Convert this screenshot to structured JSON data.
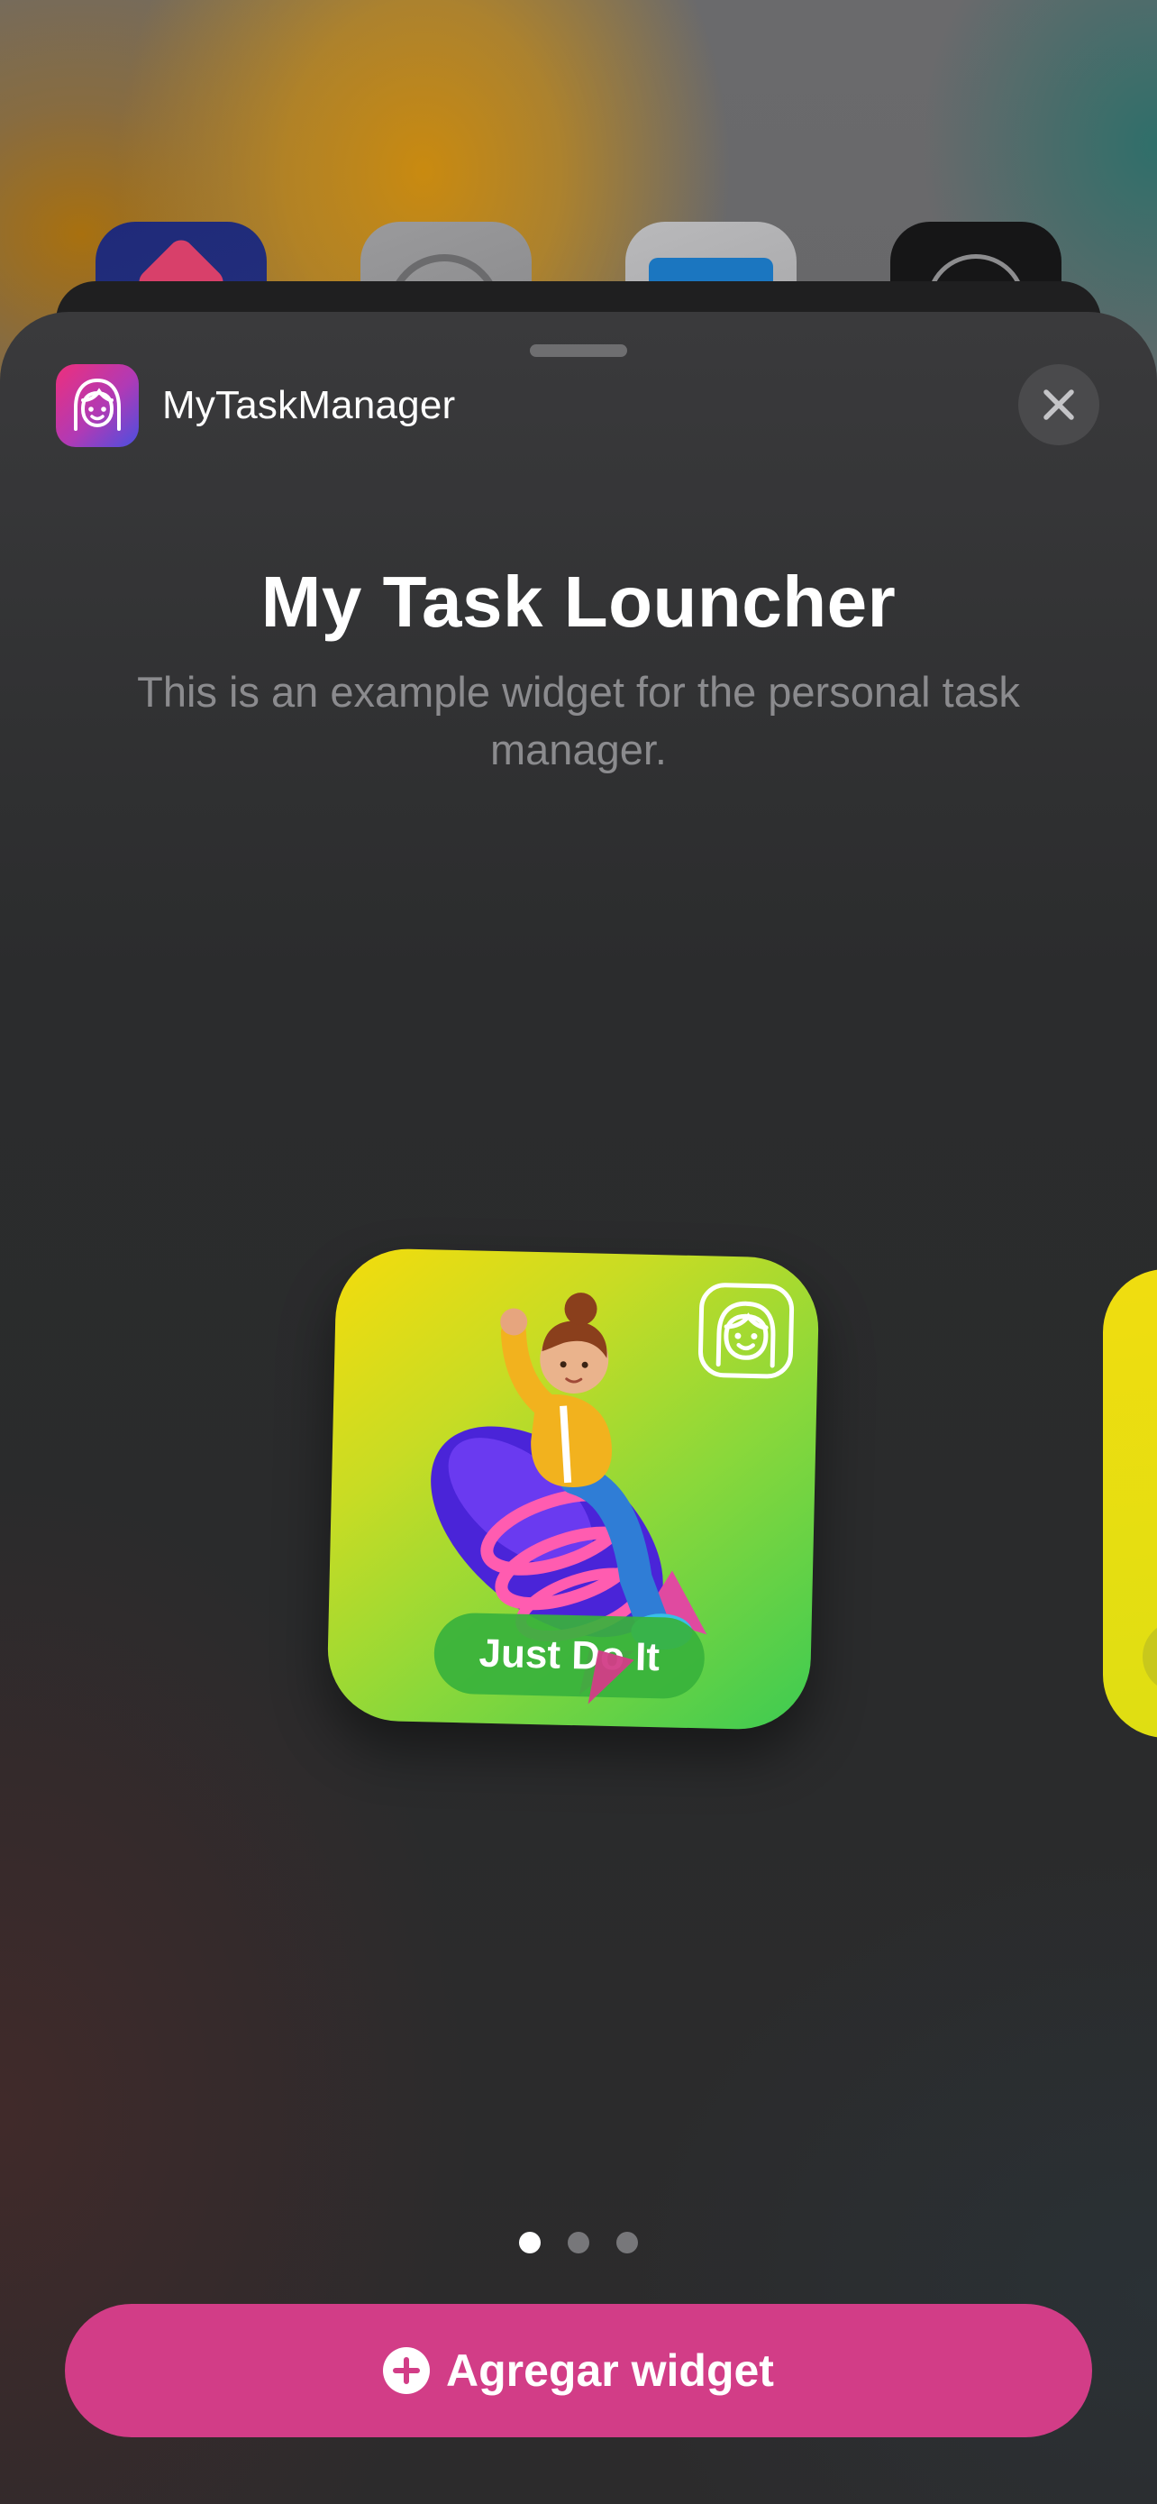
{
  "app": {
    "name": "MyTaskManager",
    "icon": "girl-face-icon",
    "brand_gradient": [
      "#ee2f7c",
      "#b03ab5",
      "#4a4fe0"
    ]
  },
  "close": {
    "icon": "close-icon"
  },
  "widget": {
    "title": "My Task Louncher",
    "description": "This is an example widget for the personal task manager.",
    "preview": {
      "cta_label": "Just Do It",
      "badge_icon": "girl-face-icon",
      "illustration": "girl-riding-rocket",
      "gradient": [
        "#f4dc0c",
        "#8bd83a",
        "#3dcb52"
      ]
    }
  },
  "pagination": {
    "total": 3,
    "current": 1
  },
  "add_button": {
    "label": "Agregar widget",
    "icon": "plus-circle-icon",
    "color": "#d23d87"
  }
}
